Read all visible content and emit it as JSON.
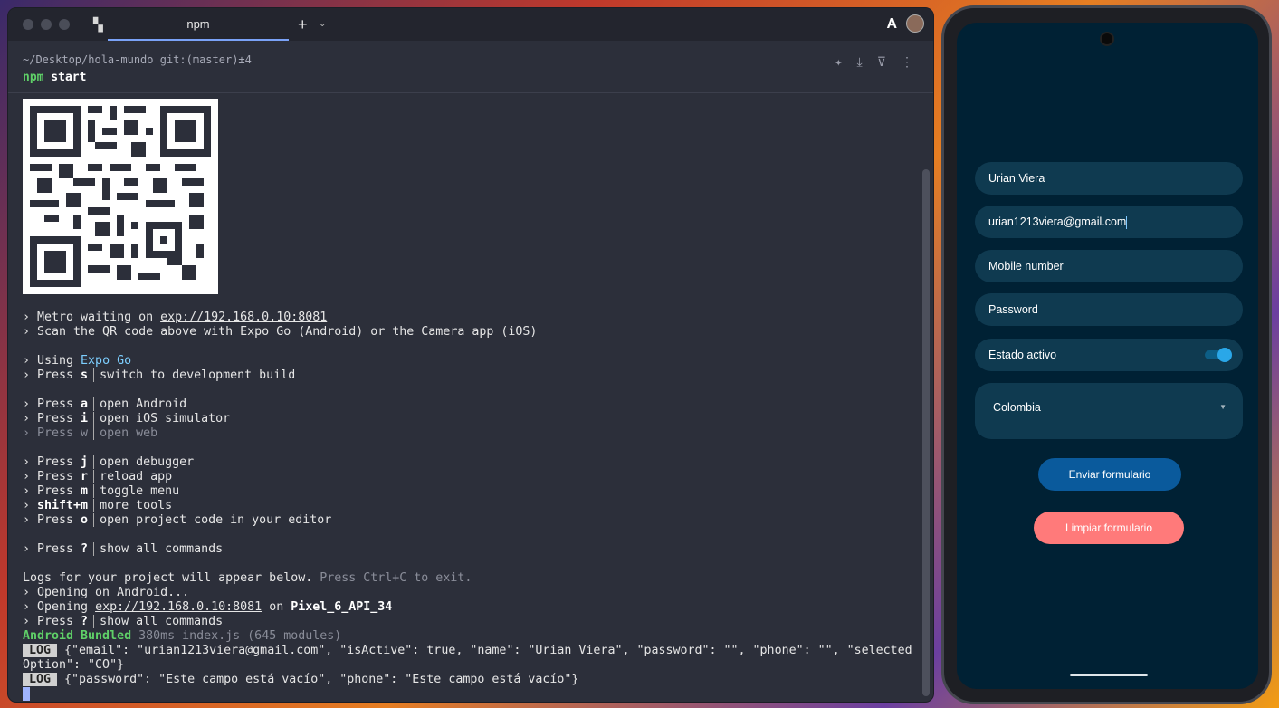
{
  "terminal": {
    "tab_title": "npm",
    "path": "~/Desktop/hola-mundo git:(master)±4",
    "command_prefix": "npm",
    "command_rest": " start",
    "lines": {
      "metro_pre": "› Metro waiting on ",
      "metro_url": "exp://192.168.0.10:8081",
      "scan": "› Scan the QR code above with Expo Go (Android) or the Camera app (iOS)",
      "using_pre": "› Using ",
      "using_expo": "Expo Go",
      "press": "› Press ",
      "keys": {
        "s": "s",
        "a": "a",
        "i": "i",
        "w": "w",
        "j": "j",
        "r": "r",
        "m": "m",
        "o": "o",
        "q": "?"
      },
      "shift_pre": "› ",
      "shift_key": "shift+m",
      "desc_s": "switch to development build",
      "desc_a": "open Android",
      "desc_i": "open iOS simulator",
      "desc_w": "open web",
      "desc_j": "open debugger",
      "desc_r": "reload app",
      "desc_m": "toggle menu",
      "desc_shift": "more tools",
      "desc_o": "open project code in your editor",
      "desc_q": "show all commands",
      "logs_a": "Logs for your project will appear below.",
      "logs_b": " Press Ctrl+C to exit.",
      "opening_android": "› Opening on Android...",
      "opening_pre": "› Opening ",
      "opening_url": "exp://192.168.0.10:8081",
      "opening_on": " on ",
      "opening_device": "Pixel_6_API_34",
      "bundled_a": "Android Bundled",
      "bundled_b": " 380ms index.js (645 modules)",
      "log_tag": "LOG",
      "log1": " {\"email\": \"urian1213viera@gmail.com\", \"isActive\": true, \"name\": \"Urian Viera\", \"password\": \"\", \"phone\": \"\", \"selected",
      "log1b": "Option\": \"CO\"}",
      "log2": " {\"password\": \"Este campo está vacío\", \"phone\": \"Este campo está vacío\"}"
    }
  },
  "phone": {
    "name_value": "Urian Viera",
    "email_value": "urian1213viera@gmail.com",
    "mobile_placeholder": "Mobile number",
    "password_placeholder": "Password",
    "active_label": "Estado activo",
    "active_on": true,
    "country_selected": "Colombia",
    "submit_label": "Enviar formulario",
    "clear_label": "Limpiar formulario",
    "colors": {
      "submit": "#0a5a9c",
      "clear": "#ff7a7a",
      "background": "#002134"
    }
  }
}
